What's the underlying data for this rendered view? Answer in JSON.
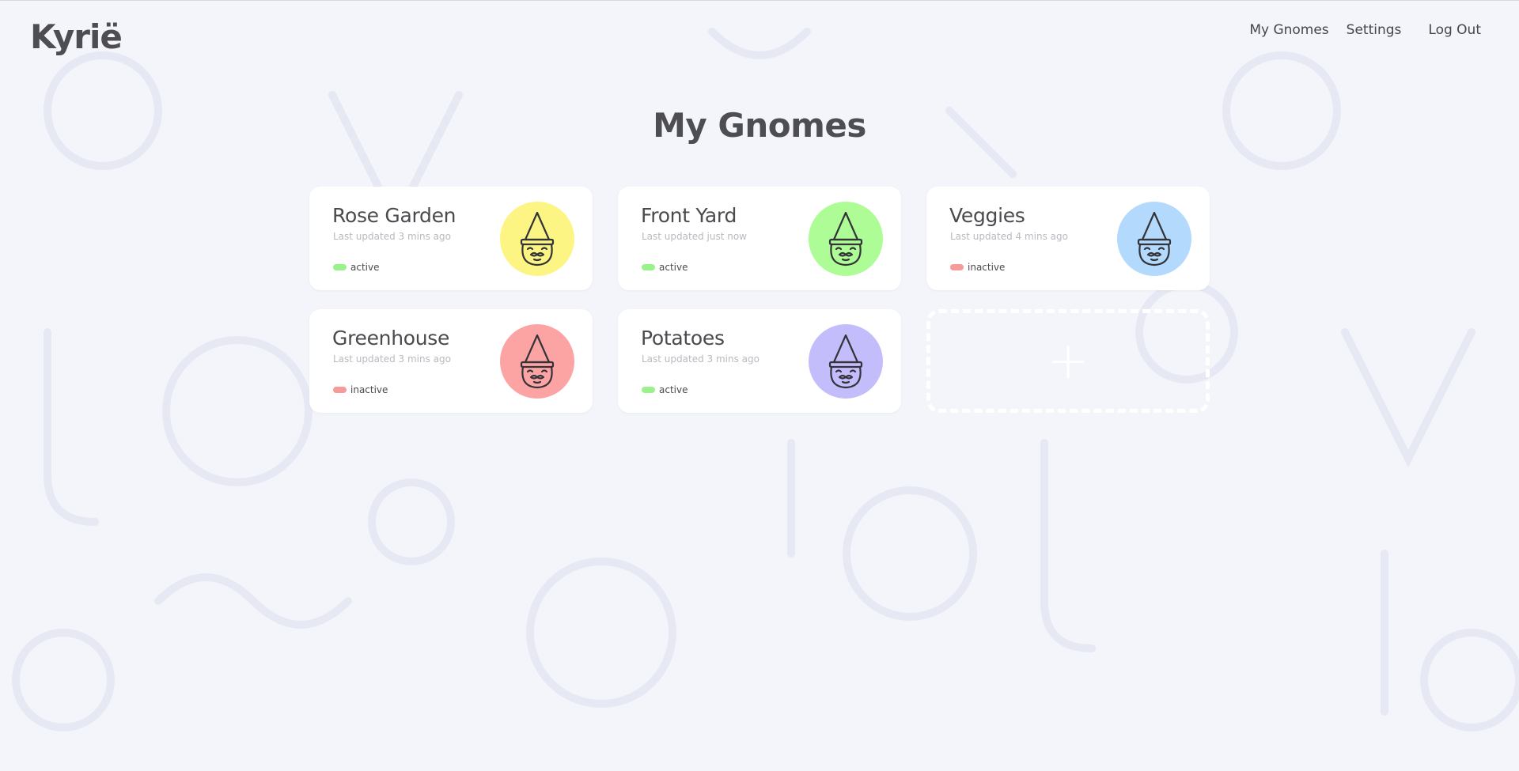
{
  "app": {
    "logo": "Kyrië"
  },
  "nav": {
    "items": [
      "My Gnomes",
      "Settings",
      "Log Out"
    ]
  },
  "page": {
    "title": "My Gnomes"
  },
  "gnomes": [
    {
      "name": "Rose Garden",
      "updated": "Last updated 3 mins ago",
      "status": "active",
      "avatar_color": "#fcf583",
      "status_color": "#9af28b"
    },
    {
      "name": "Front Yard",
      "updated": "Last updated just now",
      "status": "active",
      "avatar_color": "#aefc95",
      "status_color": "#9af28b"
    },
    {
      "name": "Veggies",
      "updated": "Last updated 4 mins ago",
      "status": "inactive",
      "avatar_color": "#b3d9fd",
      "status_color": "#f79a9a"
    },
    {
      "name": "Greenhouse",
      "updated": "Last updated 3 mins ago",
      "status": "inactive",
      "avatar_color": "#fca4a4",
      "status_color": "#f79a9a"
    },
    {
      "name": "Potatoes",
      "updated": "Last updated 3 mins ago",
      "status": "active",
      "avatar_color": "#c4bdfc",
      "status_color": "#9af28b"
    }
  ],
  "add_card": {
    "icon": "plus-icon",
    "symbol": "+"
  },
  "icons": {
    "gnome": "gnome-face-icon"
  }
}
